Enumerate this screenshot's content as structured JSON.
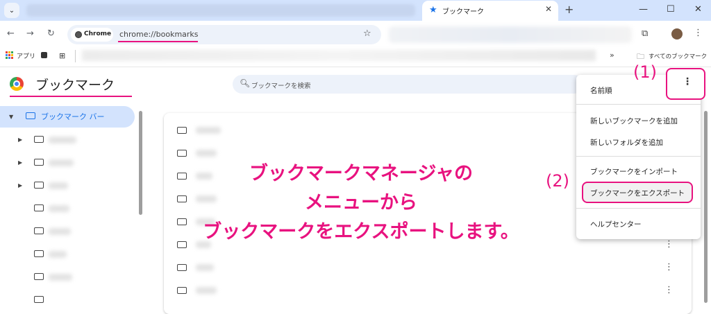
{
  "browser": {
    "tab_title": "ブックマーク",
    "url_chip": "Chrome",
    "url": "chrome://bookmarks",
    "apps_label": "アプリ",
    "all_bookmarks_label": "すべてのブックマーク"
  },
  "page": {
    "title": "ブックマーク",
    "search_placeholder": "ブックマークを検索",
    "sidebar_selected": "ブックマーク バー"
  },
  "menu": {
    "items": [
      "名前順",
      "新しいブックマークを追加",
      "新しいフォルダを追加",
      "ブックマークをインポート",
      "ブックマークをエクスポート",
      "ヘルプセンター"
    ]
  },
  "annotations": {
    "step1": "(1)",
    "step2": "(2)",
    "caption_lines": [
      "ブックマークマネージャの",
      "メニューから",
      "ブックマークをエクスポートします。"
    ]
  },
  "colors": {
    "accent": "#e8127f",
    "chrome_blue": "#1a73e8",
    "tabstrip": "#d3e3fd"
  }
}
